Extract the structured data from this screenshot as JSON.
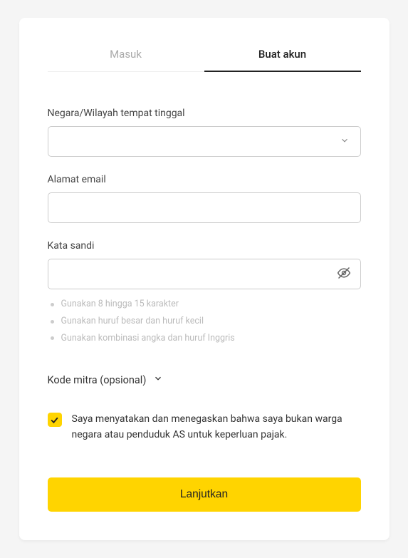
{
  "tabs": {
    "login": "Masuk",
    "register": "Buat akun"
  },
  "form": {
    "country": {
      "label": "Negara/Wilayah tempat tinggal",
      "value": ""
    },
    "email": {
      "label": "Alamat email",
      "value": ""
    },
    "password": {
      "label": "Kata sandi",
      "value": "",
      "hints": [
        "Gunakan 8 hingga 15 karakter",
        "Gunakan huruf besar dan huruf kecil",
        "Gunakan kombinasi angka dan huruf Inggris"
      ]
    },
    "partner_code": {
      "label": "Kode mitra (opsional)"
    },
    "consent": {
      "checked": true,
      "label": "Saya menyatakan dan menegaskan bahwa saya bukan warga negara atau penduduk AS untuk keperluan pajak."
    },
    "submit": "Lanjutkan"
  }
}
